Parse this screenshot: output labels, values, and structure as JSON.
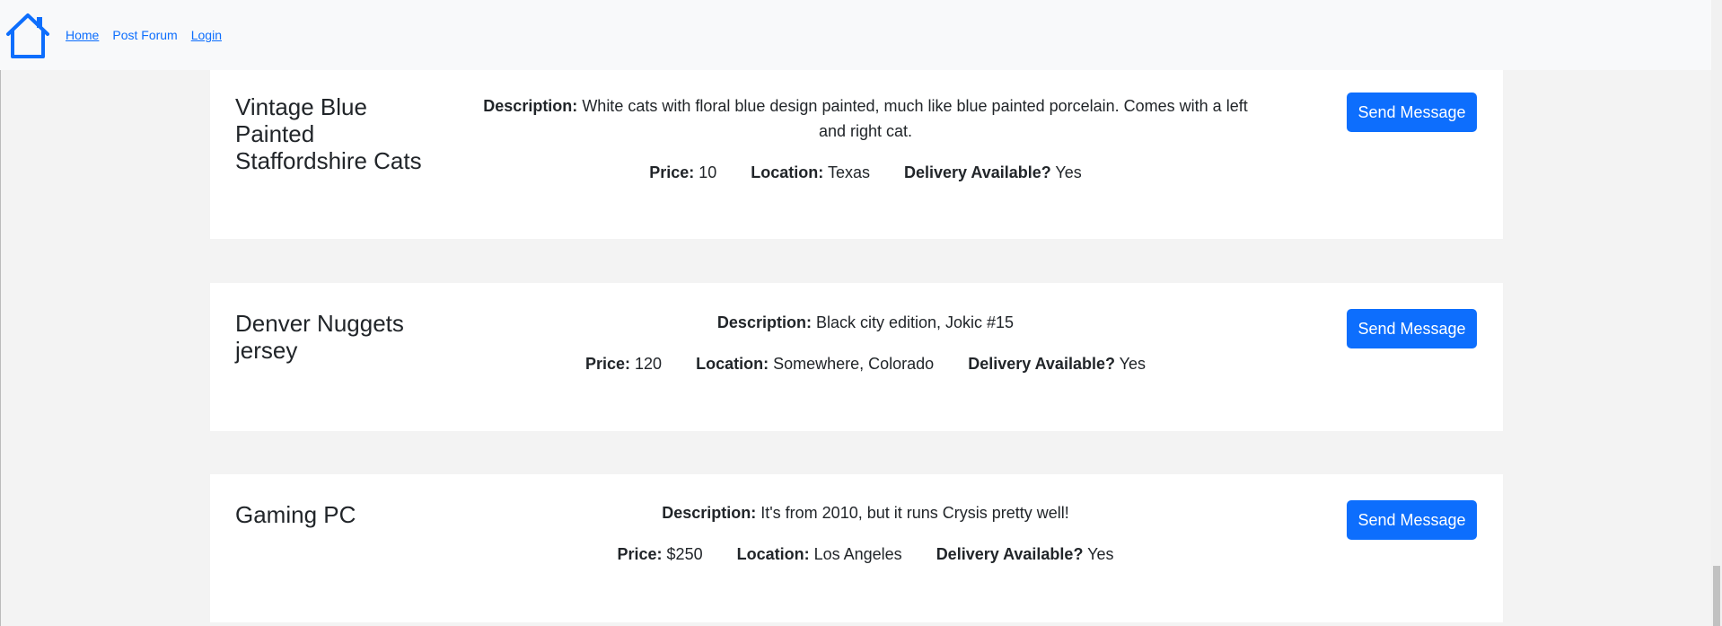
{
  "nav": {
    "home_icon": "house-icon",
    "links": [
      {
        "label": "Home"
      },
      {
        "label": "Post Forum"
      },
      {
        "label": "Login"
      }
    ]
  },
  "labels": {
    "description": "Description:",
    "price": "Price:",
    "location": "Location:",
    "delivery": "Delivery Available?",
    "send_message": "Send Message"
  },
  "listings": [
    {
      "title": "Vintage Blue Painted Staffordshire Cats",
      "description": "White cats with floral blue design painted, much like blue painted porcelain. Comes with a left and right cat.",
      "price": "10",
      "location": "Texas",
      "delivery": "Yes"
    },
    {
      "title": "Denver Nuggets jersey",
      "description": "Black city edition, Jokic #15",
      "price": "120",
      "location": "Somewhere, Colorado",
      "delivery": "Yes"
    },
    {
      "title": "Gaming PC",
      "description": "It's from 2010, but it runs Crysis pretty well!",
      "price": "$250",
      "location": "Los Angeles",
      "delivery": "Yes"
    }
  ],
  "colors": {
    "accent": "#0d6efd",
    "navbar_bg": "#f8f9fa",
    "page_bg": "#f3f3f3"
  }
}
